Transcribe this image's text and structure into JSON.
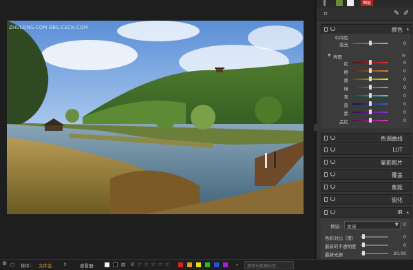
{
  "viewer": {
    "watermark": "ZHULONG.COM  BBS.CECN.COM"
  },
  "panel": {
    "thumbs": [
      "",
      "",
      "",
      "图层"
    ],
    "sections": {
      "color": {
        "label": "颜色"
      },
      "tone_curve": {
        "label": "色调曲线"
      },
      "lut": {
        "label": "LUT"
      },
      "vignette": {
        "label": "晕影照片"
      },
      "overlay": {
        "label": "覆盖"
      },
      "focus": {
        "label": "焦距"
      },
      "sharpen": {
        "label": "锐化"
      },
      "ir": {
        "label": "IR"
      }
    },
    "color_top": {
      "partial_label": "中间色",
      "highlight_label": "高光",
      "highlight_value": "0",
      "brightness_label": "亮度"
    },
    "color_rows": [
      {
        "name": "红",
        "value": "0",
        "colors": [
          "#4a1010",
          "#e03030"
        ]
      },
      {
        "name": "橙",
        "value": "0",
        "colors": [
          "#4a2a10",
          "#e08030"
        ]
      },
      {
        "name": "黄",
        "value": "0",
        "colors": [
          "#4a4a10",
          "#e0e030"
        ]
      },
      {
        "name": "绿",
        "value": "0",
        "colors": [
          "#104a10",
          "#30e030"
        ]
      },
      {
        "name": "青",
        "value": "0",
        "colors": [
          "#104a4a",
          "#30e0e0"
        ]
      },
      {
        "name": "蓝",
        "value": "0",
        "colors": [
          "#10104a",
          "#3060e0"
        ]
      },
      {
        "name": "紫",
        "value": "0",
        "colors": [
          "#2a104a",
          "#9030e0"
        ]
      },
      {
        "name": "品红",
        "value": "0",
        "colors": [
          "#4a1040",
          "#e030c0"
        ]
      }
    ],
    "ir": {
      "preset_label": "预设:",
      "preset_value": "关闭",
      "rows": [
        {
          "name": "色彩对比（度）",
          "value": "0"
        },
        {
          "name": "最新的不透明度",
          "value": "0"
        },
        {
          "name": "最新光源",
          "value": "20.00"
        }
      ]
    }
  },
  "bottom": {
    "sort_label": "排序:",
    "sort_value": "文件名",
    "view_label": "查看器:",
    "search_placeholder": "搜索元数据标签",
    "swatches": [
      "#e02020",
      "#e0a020",
      "#e0e020",
      "#20c020",
      "#2050e0",
      "#a020e0"
    ]
  },
  "colors": {
    "accent": "#e02020"
  }
}
